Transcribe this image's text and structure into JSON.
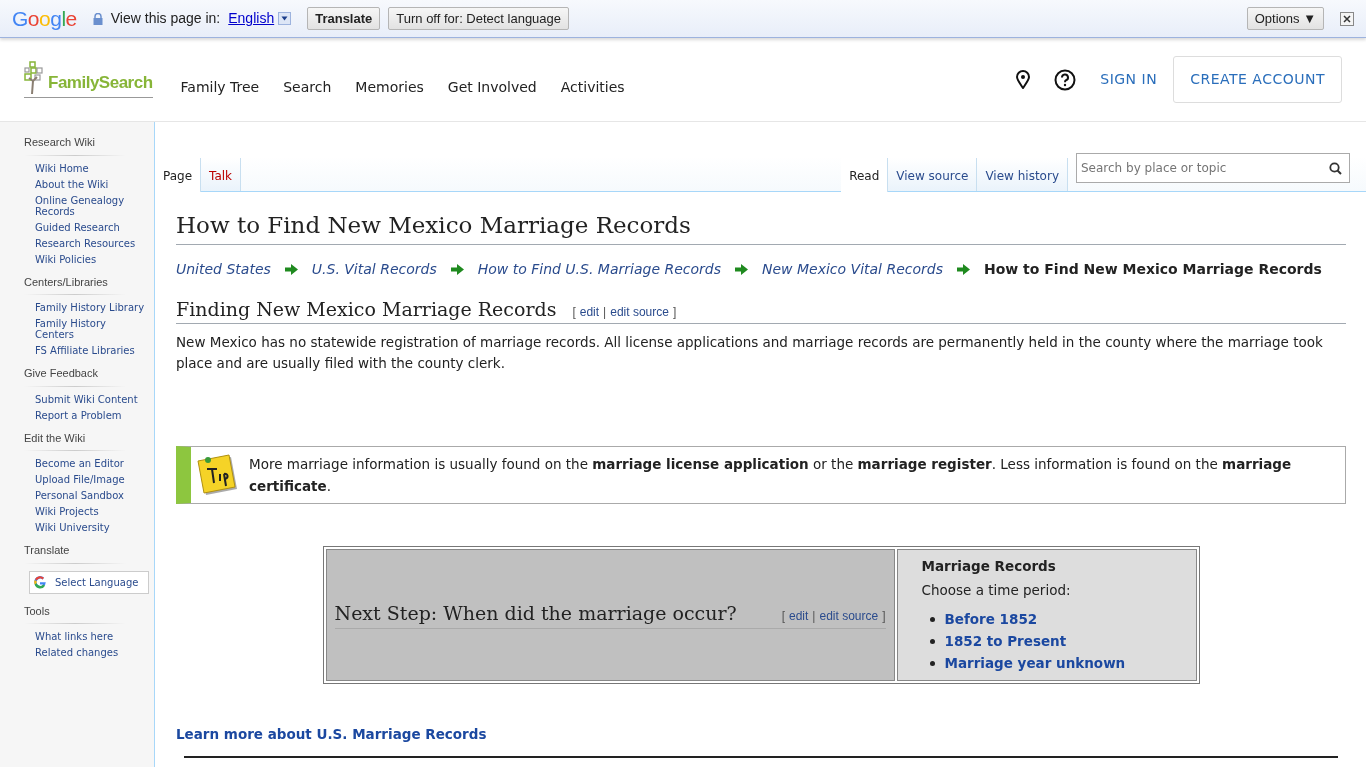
{
  "translate_bar": {
    "logo": "Google",
    "label": "View this page in:",
    "language": "English",
    "buttons": [
      "Translate",
      "Turn off for: Detect language"
    ],
    "options": "Options ▼"
  },
  "header": {
    "logo": "FamilySearch",
    "nav": [
      "Family Tree",
      "Search",
      "Memories",
      "Get Involved",
      "Activities"
    ],
    "sign_in": "SIGN IN",
    "create_account": "CREATE ACCOUNT"
  },
  "sidebar": [
    {
      "title": "Research Wiki",
      "items": [
        "Wiki Home",
        "About the Wiki",
        "Online Genealogy Records",
        "Guided Research",
        "Research Resources",
        "Wiki Policies"
      ]
    },
    {
      "title": "Centers/Libraries",
      "items": [
        "Family History Library",
        "Family History Centers",
        "FS Affiliate Libraries"
      ]
    },
    {
      "title": "Give Feedback",
      "items": [
        "Submit Wiki Content",
        "Report a Problem"
      ]
    },
    {
      "title": "Edit the Wiki",
      "items": [
        "Become an Editor",
        "Upload File/Image",
        "Personal Sandbox",
        "Wiki Projects",
        "Wiki University"
      ]
    },
    {
      "title": "Translate",
      "widget": "Select Language"
    },
    {
      "title": "Tools",
      "items": [
        "What links here",
        "Related changes"
      ]
    }
  ],
  "tabs_left": [
    {
      "label": "Page",
      "selected": true
    },
    {
      "label": "Talk",
      "selected": false
    }
  ],
  "tabs_right": [
    {
      "label": "Read",
      "selected": true
    },
    {
      "label": "View source",
      "selected": false
    },
    {
      "label": "View history",
      "selected": false
    }
  ],
  "search": {
    "placeholder": "Search by place or topic"
  },
  "title": "How to Find New Mexico Marriage Records",
  "breadcrumbs": [
    {
      "label": "United States",
      "current": false
    },
    {
      "label": "U.S. Vital Records",
      "current": false
    },
    {
      "label": "How to Find U.S. Marriage Records",
      "current": false
    },
    {
      "label": "New Mexico Vital Records",
      "current": false
    },
    {
      "label": "How to Find New Mexico Marriage Records",
      "current": true
    }
  ],
  "section": {
    "heading": "Finding New Mexico Marriage Records",
    "edit_links": [
      {
        "kind": "punct",
        "text": "["
      },
      {
        "kind": "link",
        "text": "edit"
      },
      {
        "kind": "punct",
        "text": "|"
      },
      {
        "kind": "link",
        "text": "edit source"
      },
      {
        "kind": "punct",
        "text": "]"
      }
    ],
    "paragraph": "New Mexico has no statewide registration of marriage records. All license applications and marriage records are permanently held in the county where the marriage took place and are usually filed with the county clerk."
  },
  "tip": {
    "text": "More marriage information is usually found on the **marriage license application** or the **marriage register**. Less information is found on the **marriage certificate**."
  },
  "next_step": {
    "heading": "Next Step: When did the marriage occur?",
    "edit_links": [
      {
        "kind": "punct",
        "text": "["
      },
      {
        "kind": "link",
        "text": "edit"
      },
      {
        "kind": "punct",
        "text": "|"
      },
      {
        "kind": "link",
        "text": "edit source"
      },
      {
        "kind": "punct",
        "text": "]"
      }
    ],
    "panel_title": "Marriage Records",
    "panel_subtitle": "Choose a time period:",
    "links": [
      "Before 1852",
      "1852 to Present",
      "Marriage year unknown"
    ]
  },
  "learn_more": "Learn more about U.S. Marriage Records"
}
